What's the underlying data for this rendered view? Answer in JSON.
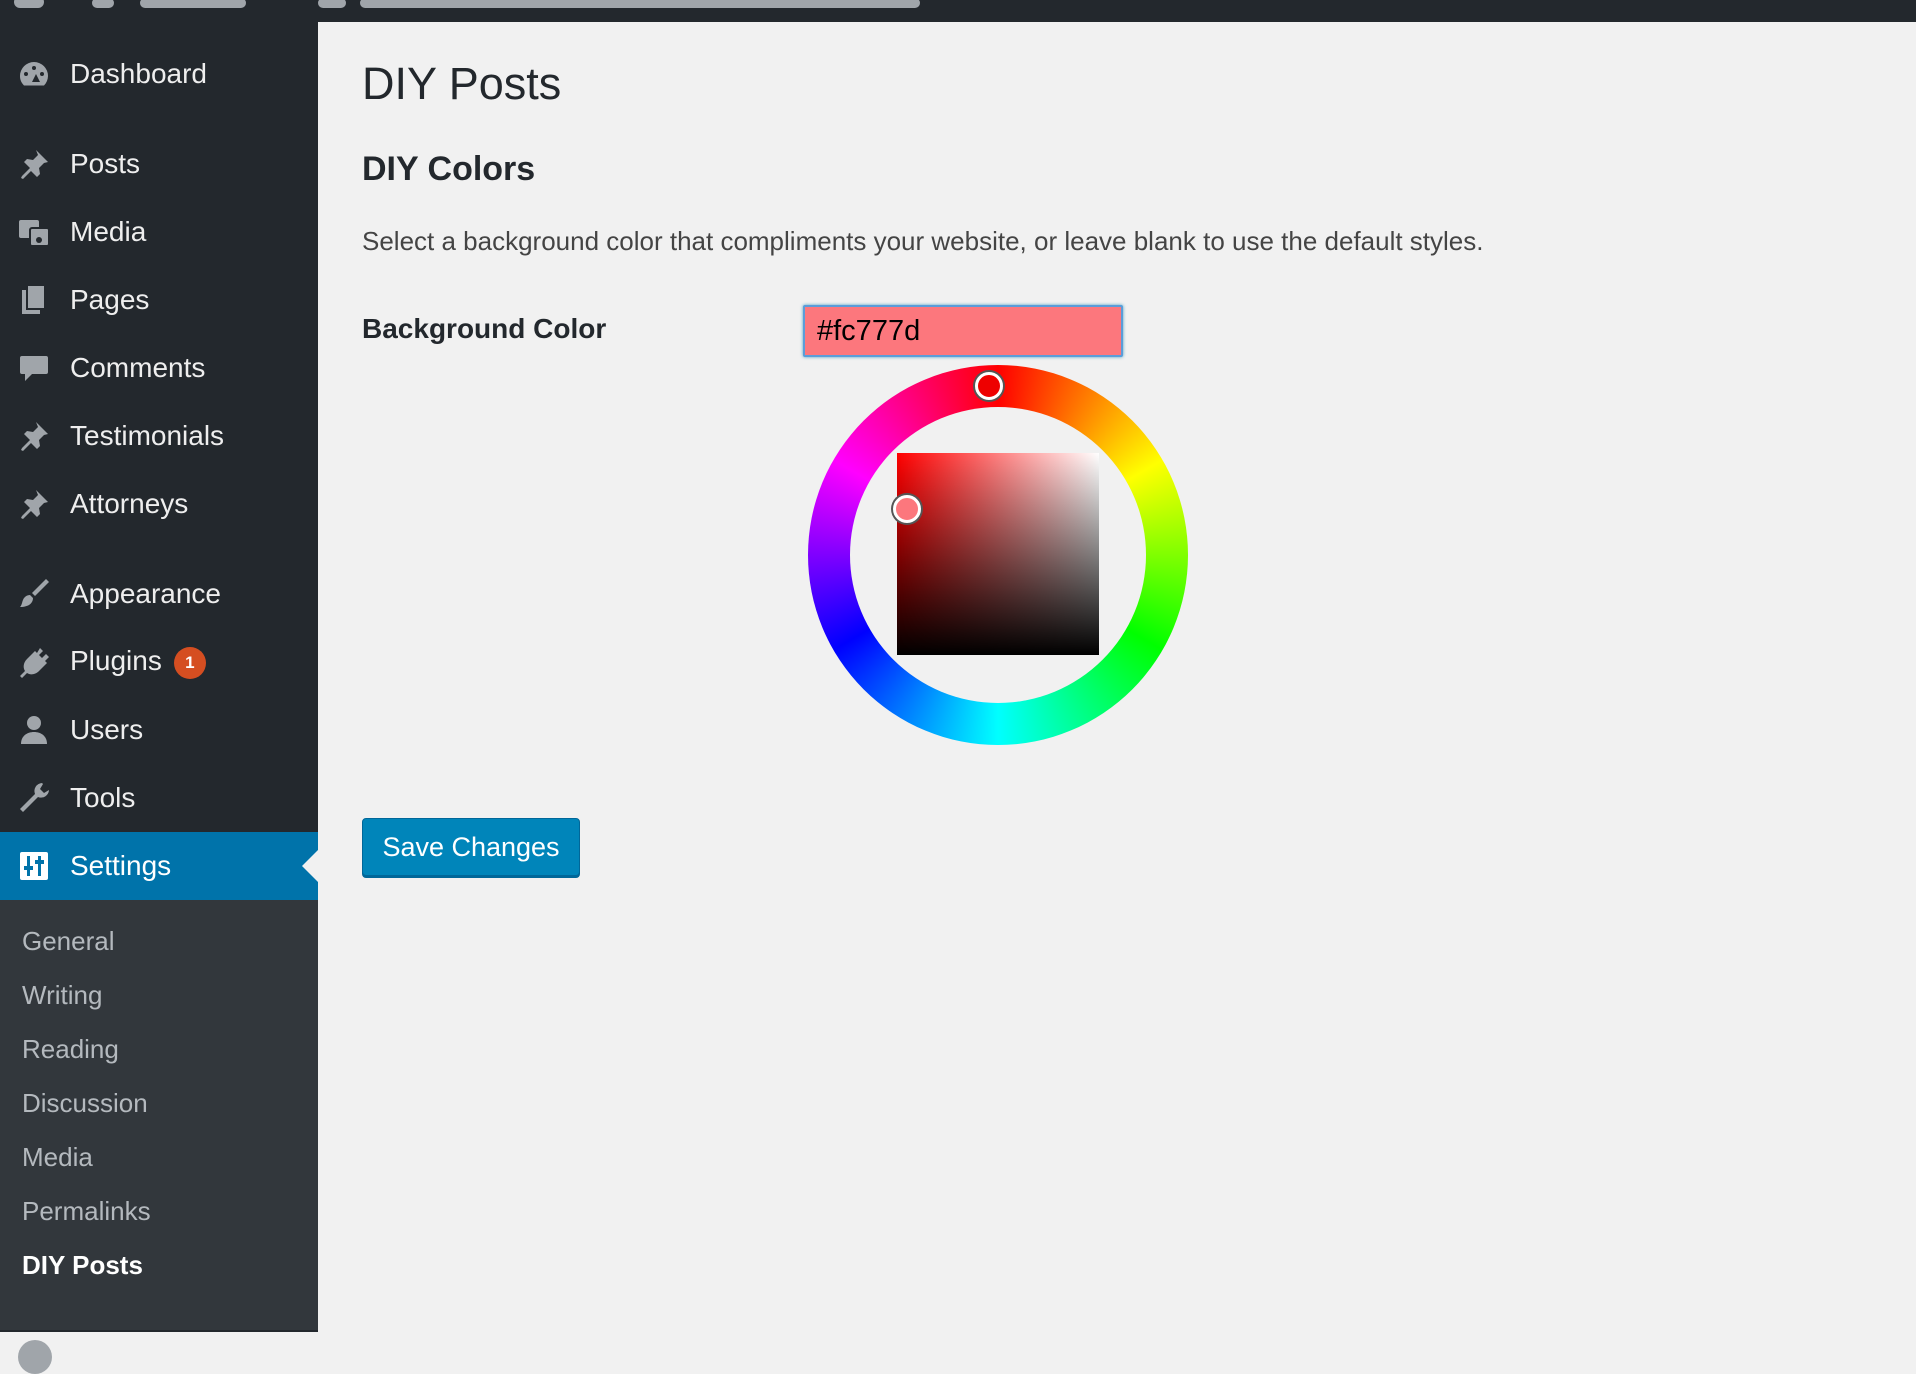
{
  "sidebar": {
    "menu": [
      {
        "label": "Dashboard",
        "icon": "dashboard-icon"
      },
      {
        "label": "Posts",
        "icon": "pushpin-icon"
      },
      {
        "label": "Media",
        "icon": "media-icon"
      },
      {
        "label": "Pages",
        "icon": "pages-icon"
      },
      {
        "label": "Comments",
        "icon": "comment-icon"
      },
      {
        "label": "Testimonials",
        "icon": "pushpin-icon"
      },
      {
        "label": "Attorneys",
        "icon": "pushpin-icon"
      },
      {
        "label": "Appearance",
        "icon": "paintbrush-icon"
      },
      {
        "label": "Plugins",
        "icon": "plug-icon",
        "badge": "1"
      },
      {
        "label": "Users",
        "icon": "user-icon"
      },
      {
        "label": "Tools",
        "icon": "wrench-icon"
      },
      {
        "label": "Settings",
        "icon": "settings-icon",
        "current": true
      }
    ],
    "submenu": [
      {
        "label": "General"
      },
      {
        "label": "Writing"
      },
      {
        "label": "Reading"
      },
      {
        "label": "Discussion"
      },
      {
        "label": "Media"
      },
      {
        "label": "Permalinks"
      },
      {
        "label": "DIY Posts",
        "current": true
      }
    ]
  },
  "main": {
    "page_title": "DIY Posts",
    "section_title": "DIY Colors",
    "description": "Select a background color that compliments your website, or leave blank to use the default styles.",
    "field_label": "Background Color",
    "color_value": "#fc777d",
    "save_label": "Save Changes"
  },
  "colors": {
    "sidebar_bg": "#23282d",
    "submenu_bg": "#32373c",
    "accent": "#0073aa",
    "button": "#0085ba",
    "badge": "#d54e21",
    "selected_color": "#fc777d"
  }
}
